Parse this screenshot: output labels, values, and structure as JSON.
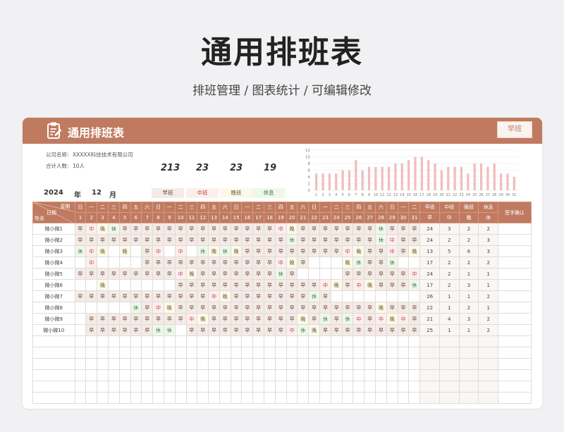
{
  "page": {
    "title": "通用排班表",
    "subtitle": "排班管理 / 图表统计 / 可编辑修改"
  },
  "header": {
    "title": "通用排班表",
    "shift_select": "早班"
  },
  "info": {
    "company_label": "公司名称:",
    "company_value": "XXXXX科技技术有限公司",
    "people_label": "合计人数:",
    "people_value": "10人"
  },
  "totals": [
    "213",
    "23",
    "23",
    "19"
  ],
  "date": {
    "year": "2024",
    "year_unit": "年",
    "month": "12",
    "month_unit": "月"
  },
  "legend": [
    "早班",
    "中班",
    "晚班",
    "休息"
  ],
  "colors": {
    "accent": "#bf7a60",
    "early": "#f4ebe6",
    "middle": "#fdeeee",
    "late": "#fdf9e9",
    "rest": "#eef7ea",
    "bar": "#f2bcbc"
  },
  "table": {
    "corner_top": "星期",
    "corner_mid": "日期",
    "corner_bottom": "姓名",
    "weekdays": [
      "日",
      "一",
      "二",
      "三",
      "四",
      "五",
      "六",
      "日",
      "一",
      "二",
      "三",
      "四",
      "五",
      "六",
      "日",
      "一",
      "二",
      "三",
      "四",
      "五",
      "六",
      "日",
      "一",
      "二",
      "三",
      "四",
      "五",
      "六",
      "日",
      "一",
      "二"
    ],
    "days": [
      "1",
      "2",
      "3",
      "4",
      "5",
      "6",
      "7",
      "8",
      "9",
      "10",
      "11",
      "12",
      "13",
      "14",
      "15",
      "16",
      "17",
      "18",
      "19",
      "20",
      "21",
      "22",
      "23",
      "24",
      "25",
      "26",
      "27",
      "28",
      "29",
      "30",
      "31"
    ],
    "summary_headers": [
      {
        "top": "早班",
        "bottom": "早"
      },
      {
        "top": "中班",
        "bottom": "中"
      },
      {
        "top": "晚班",
        "bottom": "晚"
      },
      {
        "top": "休息",
        "bottom": "休"
      }
    ],
    "sign_header": "签字确认",
    "rows": [
      {
        "name": "微小微1",
        "shifts": [
          "早",
          "中",
          "晚",
          "休",
          "早",
          "早",
          "早",
          "早",
          "早",
          "早",
          "早",
          "早",
          "早",
          "早",
          "早",
          "早",
          "早",
          "早",
          "中",
          "晚",
          "早",
          "早",
          "早",
          "早",
          "早",
          "早",
          "早",
          "休",
          "早",
          "早",
          "早"
        ],
        "summary": [
          "24",
          "3",
          "2",
          "2"
        ]
      },
      {
        "name": "微小微2",
        "shifts": [
          "早",
          "早",
          "早",
          "早",
          "早",
          "早",
          "早",
          "早",
          "早",
          "早",
          "早",
          "早",
          "早",
          "早",
          "早",
          "早",
          "早",
          "早",
          "早",
          "休",
          "早",
          "早",
          "早",
          "早",
          "早",
          "早",
          "早",
          "休",
          "中",
          "早",
          "早"
        ],
        "summary": [
          "24",
          "2",
          "2",
          "3"
        ]
      },
      {
        "name": "微小微3",
        "shifts": [
          "休",
          "中",
          "晚",
          "",
          "晚",
          "",
          "早",
          "中",
          "",
          "中",
          "",
          "休",
          "晚",
          "休",
          "晚",
          "早",
          "早",
          "早",
          "早",
          "早",
          "早",
          "早",
          "早",
          "早",
          "中",
          "晚",
          "早",
          "早",
          "中",
          "早",
          "晚"
        ],
        "summary": [
          "13",
          "5",
          "6",
          "3"
        ]
      },
      {
        "name": "微小微4",
        "shifts": [
          "",
          "中",
          "",
          "",
          "",
          "",
          "早",
          "早",
          "早",
          "早",
          "早",
          "早",
          "早",
          "早",
          "早",
          "早",
          "早",
          "早",
          "中",
          "晚",
          "早",
          "",
          "",
          "",
          "晚",
          "休",
          "早",
          "早",
          "休",
          "",
          ""
        ],
        "summary": [
          "17",
          "2",
          "2",
          "2"
        ]
      },
      {
        "name": "微小微5",
        "shifts": [
          "早",
          "早",
          "早",
          "早",
          "早",
          "早",
          "早",
          "早",
          "早",
          "中",
          "晚",
          "早",
          "早",
          "早",
          "早",
          "早",
          "早",
          "早",
          "休",
          "早",
          "",
          "",
          "",
          "",
          "早",
          "早",
          "早",
          "早",
          "早",
          "早",
          "中"
        ],
        "summary": [
          "24",
          "2",
          "1",
          "1"
        ]
      },
      {
        "name": "微小微6",
        "shifts": [
          "",
          "",
          "晚",
          "",
          "",
          "",
          "",
          "",
          "",
          "早",
          "早",
          "早",
          "早",
          "早",
          "早",
          "早",
          "早",
          "早",
          "早",
          "早",
          "早",
          "早",
          "中",
          "晚",
          "早",
          "中",
          "晚",
          "早",
          "早",
          "早",
          "休"
        ],
        "summary": [
          "17",
          "2",
          "3",
          "1"
        ]
      },
      {
        "name": "微小微7",
        "shifts": [
          "早",
          "早",
          "早",
          "早",
          "早",
          "早",
          "早",
          "早",
          "早",
          "早",
          "早",
          "早",
          "中",
          "晚",
          "早",
          "早",
          "早",
          "早",
          "早",
          "早",
          "早",
          "休",
          "早",
          "",
          "",
          "",
          "",
          "",
          "",
          "",
          ""
        ],
        "summary": [
          "26",
          "1",
          "1",
          "2"
        ]
      },
      {
        "name": "微小微8",
        "shifts": [
          "",
          "",
          "",
          "",
          "",
          "休",
          "早",
          "中",
          "晚",
          "早",
          "早",
          "早",
          "早",
          "早",
          "早",
          "早",
          "早",
          "早",
          "早",
          "早",
          "早",
          "早",
          "早",
          "早",
          "早",
          "早",
          "早",
          "晚",
          "早",
          "早",
          "早"
        ],
        "summary": [
          "22",
          "1",
          "2",
          "1"
        ]
      },
      {
        "name": "微小微9",
        "shifts": [
          "",
          "早",
          "早",
          "早",
          "早",
          "早",
          "早",
          "早",
          "早",
          "早",
          "中",
          "晚",
          "早",
          "早",
          "早",
          "早",
          "早",
          "早",
          "早",
          "早",
          "晚",
          "早",
          "休",
          "早",
          "休",
          "中",
          "早",
          "中",
          "晚",
          "中",
          "早"
        ],
        "summary": [
          "21",
          "4",
          "3",
          "2"
        ]
      },
      {
        "name": "微小微10",
        "shifts": [
          "",
          "早",
          "早",
          "早",
          "早",
          "早",
          "早",
          "休",
          "休",
          "",
          "早",
          "早",
          "早",
          "早",
          "早",
          "早",
          "早",
          "早",
          "早",
          "中",
          "休",
          "晚",
          "早",
          "早",
          "早",
          "早",
          "早",
          "早",
          "早",
          "早",
          "早"
        ],
        "summary": [
          "25",
          "1",
          "1",
          "2"
        ]
      }
    ],
    "empty_rows": 6
  },
  "chart_data": {
    "type": "bar",
    "categories": [
      "1",
      "2",
      "3",
      "4",
      "5",
      "6",
      "7",
      "8",
      "9",
      "10",
      "11",
      "12",
      "13",
      "14",
      "15",
      "16",
      "17",
      "18",
      "19",
      "20",
      "21",
      "22",
      "23",
      "24",
      "25",
      "26",
      "27",
      "28",
      "29",
      "30",
      "31"
    ],
    "values": [
      5,
      5,
      5,
      5,
      6,
      6,
      9,
      6,
      7,
      7,
      7,
      7,
      8,
      8,
      9,
      10,
      10,
      9,
      8,
      6,
      7,
      7,
      7,
      5,
      8,
      8,
      7,
      8,
      5,
      5,
      4
    ],
    "ylim": [
      0,
      12
    ],
    "yticks": [
      "0",
      "2",
      "4",
      "6",
      "8",
      "10",
      "12"
    ],
    "grid": true
  }
}
